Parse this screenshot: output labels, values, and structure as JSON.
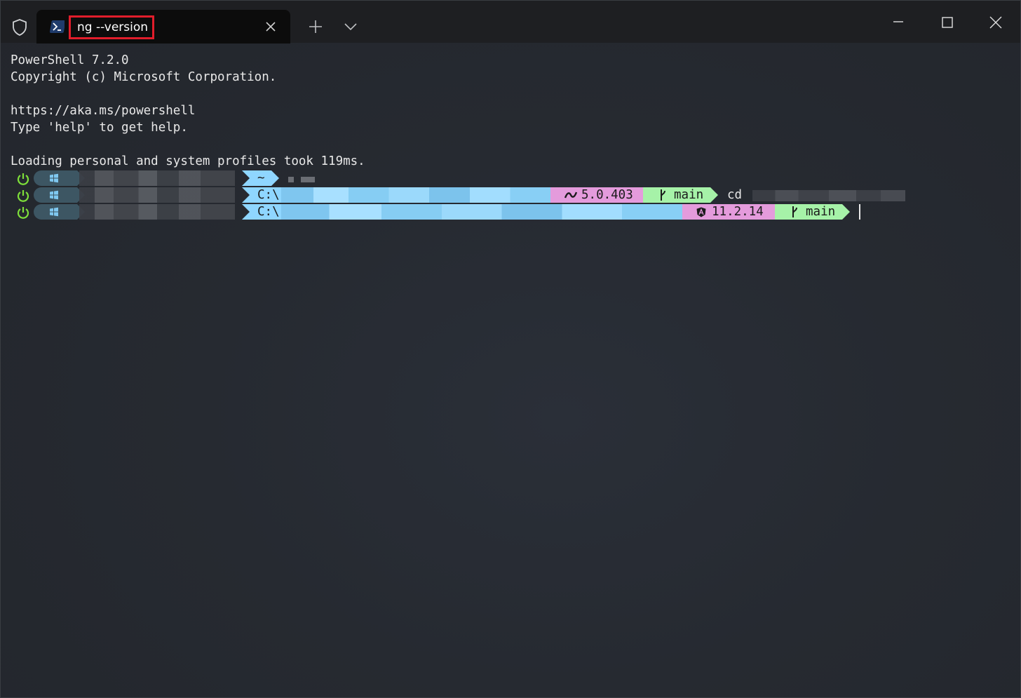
{
  "tab": {
    "title": "ng --version"
  },
  "terminal": {
    "lines": [
      "PowerShell 7.2.0",
      "Copyright (c) Microsoft Corporation.",
      "",
      "https://aka.ms/powershell",
      "Type 'help' to get help.",
      "",
      "Loading personal and system profiles took 119ms."
    ]
  },
  "prompts": {
    "row1": {
      "path": "~"
    },
    "row2": {
      "path": "C:\\",
      "dotnet_version": "5.0.403",
      "branch": "main",
      "command": "cd"
    },
    "row3": {
      "path": "C:\\",
      "angular_version": "11.2.14",
      "branch": "main"
    }
  },
  "colors": {
    "path_segment": "#8fd6ff",
    "dotnet_segment": "#e49bdc",
    "git_segment": "#a6f2a8",
    "os_segment": "#3d5663",
    "power_icon": "#7ee03a",
    "tab_highlight_border": "#e11d2b"
  },
  "icons": [
    "shield-icon",
    "powershell-icon",
    "close-icon",
    "plus-icon",
    "chevron-down-icon",
    "minimize-icon",
    "maximize-icon",
    "window-close-icon",
    "power-icon",
    "windows-logo-icon",
    "dotnet-icon",
    "git-branch-icon",
    "angular-icon"
  ]
}
